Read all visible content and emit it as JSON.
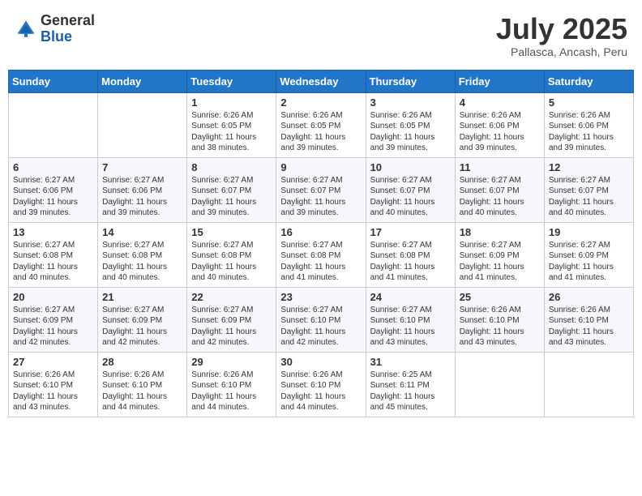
{
  "header": {
    "logo_general": "General",
    "logo_blue": "Blue",
    "month_year": "July 2025",
    "subtitle": "Pallasca, Ancash, Peru"
  },
  "weekdays": [
    "Sunday",
    "Monday",
    "Tuesday",
    "Wednesday",
    "Thursday",
    "Friday",
    "Saturday"
  ],
  "weeks": [
    [
      {
        "day": "",
        "content": ""
      },
      {
        "day": "",
        "content": ""
      },
      {
        "day": "1",
        "content": "Sunrise: 6:26 AM\nSunset: 6:05 PM\nDaylight: 11 hours and 38 minutes."
      },
      {
        "day": "2",
        "content": "Sunrise: 6:26 AM\nSunset: 6:05 PM\nDaylight: 11 hours and 39 minutes."
      },
      {
        "day": "3",
        "content": "Sunrise: 6:26 AM\nSunset: 6:05 PM\nDaylight: 11 hours and 39 minutes."
      },
      {
        "day": "4",
        "content": "Sunrise: 6:26 AM\nSunset: 6:06 PM\nDaylight: 11 hours and 39 minutes."
      },
      {
        "day": "5",
        "content": "Sunrise: 6:26 AM\nSunset: 6:06 PM\nDaylight: 11 hours and 39 minutes."
      }
    ],
    [
      {
        "day": "6",
        "content": "Sunrise: 6:27 AM\nSunset: 6:06 PM\nDaylight: 11 hours and 39 minutes."
      },
      {
        "day": "7",
        "content": "Sunrise: 6:27 AM\nSunset: 6:06 PM\nDaylight: 11 hours and 39 minutes."
      },
      {
        "day": "8",
        "content": "Sunrise: 6:27 AM\nSunset: 6:07 PM\nDaylight: 11 hours and 39 minutes."
      },
      {
        "day": "9",
        "content": "Sunrise: 6:27 AM\nSunset: 6:07 PM\nDaylight: 11 hours and 39 minutes."
      },
      {
        "day": "10",
        "content": "Sunrise: 6:27 AM\nSunset: 6:07 PM\nDaylight: 11 hours and 40 minutes."
      },
      {
        "day": "11",
        "content": "Sunrise: 6:27 AM\nSunset: 6:07 PM\nDaylight: 11 hours and 40 minutes."
      },
      {
        "day": "12",
        "content": "Sunrise: 6:27 AM\nSunset: 6:07 PM\nDaylight: 11 hours and 40 minutes."
      }
    ],
    [
      {
        "day": "13",
        "content": "Sunrise: 6:27 AM\nSunset: 6:08 PM\nDaylight: 11 hours and 40 minutes."
      },
      {
        "day": "14",
        "content": "Sunrise: 6:27 AM\nSunset: 6:08 PM\nDaylight: 11 hours and 40 minutes."
      },
      {
        "day": "15",
        "content": "Sunrise: 6:27 AM\nSunset: 6:08 PM\nDaylight: 11 hours and 40 minutes."
      },
      {
        "day": "16",
        "content": "Sunrise: 6:27 AM\nSunset: 6:08 PM\nDaylight: 11 hours and 41 minutes."
      },
      {
        "day": "17",
        "content": "Sunrise: 6:27 AM\nSunset: 6:08 PM\nDaylight: 11 hours and 41 minutes."
      },
      {
        "day": "18",
        "content": "Sunrise: 6:27 AM\nSunset: 6:09 PM\nDaylight: 11 hours and 41 minutes."
      },
      {
        "day": "19",
        "content": "Sunrise: 6:27 AM\nSunset: 6:09 PM\nDaylight: 11 hours and 41 minutes."
      }
    ],
    [
      {
        "day": "20",
        "content": "Sunrise: 6:27 AM\nSunset: 6:09 PM\nDaylight: 11 hours and 42 minutes."
      },
      {
        "day": "21",
        "content": "Sunrise: 6:27 AM\nSunset: 6:09 PM\nDaylight: 11 hours and 42 minutes."
      },
      {
        "day": "22",
        "content": "Sunrise: 6:27 AM\nSunset: 6:09 PM\nDaylight: 11 hours and 42 minutes."
      },
      {
        "day": "23",
        "content": "Sunrise: 6:27 AM\nSunset: 6:10 PM\nDaylight: 11 hours and 42 minutes."
      },
      {
        "day": "24",
        "content": "Sunrise: 6:27 AM\nSunset: 6:10 PM\nDaylight: 11 hours and 43 minutes."
      },
      {
        "day": "25",
        "content": "Sunrise: 6:26 AM\nSunset: 6:10 PM\nDaylight: 11 hours and 43 minutes."
      },
      {
        "day": "26",
        "content": "Sunrise: 6:26 AM\nSunset: 6:10 PM\nDaylight: 11 hours and 43 minutes."
      }
    ],
    [
      {
        "day": "27",
        "content": "Sunrise: 6:26 AM\nSunset: 6:10 PM\nDaylight: 11 hours and 43 minutes."
      },
      {
        "day": "28",
        "content": "Sunrise: 6:26 AM\nSunset: 6:10 PM\nDaylight: 11 hours and 44 minutes."
      },
      {
        "day": "29",
        "content": "Sunrise: 6:26 AM\nSunset: 6:10 PM\nDaylight: 11 hours and 44 minutes."
      },
      {
        "day": "30",
        "content": "Sunrise: 6:26 AM\nSunset: 6:10 PM\nDaylight: 11 hours and 44 minutes."
      },
      {
        "day": "31",
        "content": "Sunrise: 6:25 AM\nSunset: 6:11 PM\nDaylight: 11 hours and 45 minutes."
      },
      {
        "day": "",
        "content": ""
      },
      {
        "day": "",
        "content": ""
      }
    ]
  ]
}
